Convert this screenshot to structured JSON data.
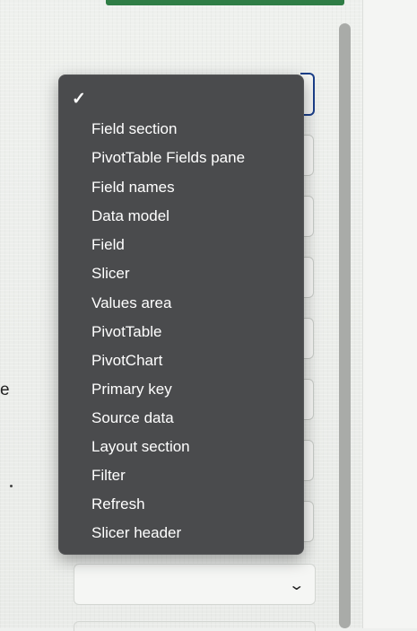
{
  "left_fragment": "e",
  "menu": {
    "check_mark": "✓",
    "items": [
      "Field section",
      "PivotTable Fields pane",
      "Field names",
      "Data model",
      "Field",
      "Slicer",
      "Values area",
      "PivotTable",
      "PivotChart",
      "Primary key",
      "Source data",
      "Layout section",
      "Filter",
      "Refresh",
      "Slicer header"
    ]
  },
  "bottom_select": {
    "value": "",
    "chevron": "⌄"
  },
  "colors": {
    "menu_bg": "#4a4b4d",
    "menu_text": "#ffffff",
    "focus_border": "#1b3f8a",
    "scrollbar": "#a9aba8",
    "top_bar": "#2f7d45"
  },
  "icons": [
    "checkmark-icon",
    "chevron-down-icon"
  ]
}
